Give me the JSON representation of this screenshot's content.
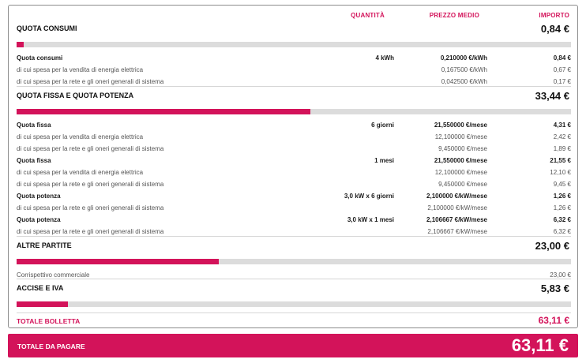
{
  "headers": {
    "quantity": "QUANTITÀ",
    "price": "PREZZO MEDIO",
    "amount": "IMPORTO"
  },
  "sections": {
    "consumi": {
      "title": "QUOTA CONSUMI",
      "total": "0,84 €",
      "bar_fraction": 0.0125,
      "rows": [
        {
          "label": "Quota consumi",
          "qty": "4 kWh",
          "price": "0,210000 €/kWh",
          "amount": "0,84 €"
        },
        {
          "label": "di cui spesa per la vendita di energia elettrica",
          "qty": "",
          "price": "0,167500 €/kWh",
          "amount": "0,67 €"
        },
        {
          "label": "di cui spesa per la rete e gli oneri generali di sistema",
          "qty": "",
          "price": "0,042500 €/kWh",
          "amount": "0,17 €"
        }
      ]
    },
    "fissa": {
      "title": "QUOTA FISSA E QUOTA POTENZA",
      "total": "33,44 €",
      "bar_fraction": 0.53,
      "rows": [
        {
          "label": "Quota fissa",
          "qty": "6 giorni",
          "price": "21,550000 €/mese",
          "amount": "4,31 €"
        },
        {
          "label": "di cui spesa per la vendita di energia elettrica",
          "qty": "",
          "price": "12,100000  €/mese",
          "amount": "2,42 €"
        },
        {
          "label": "di cui spesa per la rete e gli oneri generali di sistema",
          "qty": "",
          "price": "9,450000  €/mese",
          "amount": "1,89 €"
        },
        {
          "label": "Quota fissa",
          "qty": "1 mesi",
          "price": "21,550000 €/mese",
          "amount": "21,55 €"
        },
        {
          "label": "di cui spesa per la vendita di energia elettrica",
          "qty": "",
          "price": "12,100000  €/mese",
          "amount": "12,10 €"
        },
        {
          "label": "di cui spesa per la rete e gli oneri generali di sistema",
          "qty": "",
          "price": "9,450000  €/mese",
          "amount": "9,45 €"
        },
        {
          "label": "Quota potenza",
          "qty": "3,0 kW x 6 giorni",
          "price": "2,100000 €/kW/mese",
          "amount": "1,26 €"
        },
        {
          "label": "di cui spesa per la rete e gli oneri generali di sistema",
          "qty": "",
          "price": "2,100000  €/kW/mese",
          "amount": "1,26 €"
        },
        {
          "label": "Quota potenza",
          "qty": "3,0 kW x 1 mesi",
          "price": "2,106667 €/kW/mese",
          "amount": "6,32 €"
        },
        {
          "label": "di cui spesa per la rete e gli oneri generali di sistema",
          "qty": "",
          "price": "2,106667  €/kW/mese",
          "amount": "6,32 €"
        }
      ]
    },
    "altre": {
      "title": "ALTRE PARTITE",
      "total": "23,00 €",
      "bar_fraction": 0.365,
      "rows": [
        {
          "label": "Corrispettivo commerciale",
          "qty": "",
          "price": "",
          "amount": "23,00 €"
        }
      ]
    },
    "accise": {
      "title": "ACCISE E IVA",
      "total": "5,83 €",
      "bar_fraction": 0.092,
      "rows": []
    }
  },
  "totale_bolletta": {
    "label": "TOTALE BOLLETTA",
    "amount": "63,11 €"
  },
  "totale_pagare": {
    "label": "TOTALE DA PAGARE",
    "amount": "63,11 €"
  },
  "colors": {
    "accent": "#d3135a",
    "track": "#dcdcdc"
  }
}
